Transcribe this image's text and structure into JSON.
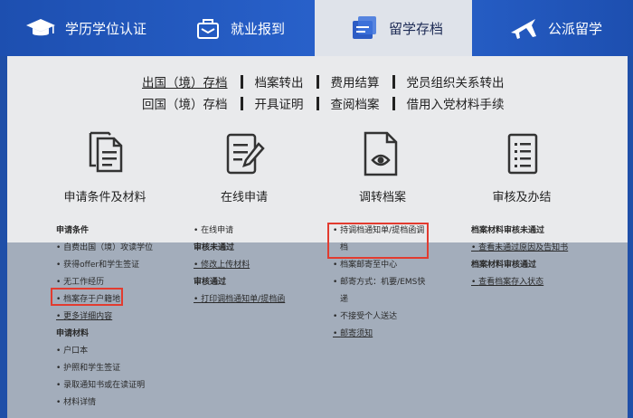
{
  "nav": {
    "items": [
      {
        "label": "学历学位认证",
        "icon": "graduation-cap-icon"
      },
      {
        "label": "就业报到",
        "icon": "job-report-icon"
      },
      {
        "label": "留学存档",
        "icon": "archive-icon"
      },
      {
        "label": "公派留学",
        "icon": "airplane-icon"
      }
    ],
    "active": "留学存档"
  },
  "links": {
    "row1": [
      "出国（境）存档",
      "档案转出",
      "费用结算",
      "党员组织关系转出"
    ],
    "row2": [
      "回国（境）存档",
      "开具证明",
      "查阅档案",
      "借用入党材料手续"
    ]
  },
  "columns": [
    {
      "title": "申请条件及材料",
      "icon": "documents-icon"
    },
    {
      "title": "在线申请",
      "icon": "edit-form-icon"
    },
    {
      "title": "调转档案",
      "icon": "file-eye-icon"
    },
    {
      "title": "审核及办结",
      "icon": "checklist-icon"
    }
  ],
  "lists": {
    "col1": [
      {
        "t": "申请条件",
        "k": "h"
      },
      {
        "t": "自费出国（境）攻读学位",
        "k": "b"
      },
      {
        "t": "获得offer和学生签证",
        "k": "b"
      },
      {
        "t": "无工作经历",
        "k": "b"
      },
      {
        "t": "档案存于户籍地",
        "k": "b"
      },
      {
        "t": "更多详细内容",
        "k": "bu"
      },
      {
        "t": "申请材料",
        "k": "h"
      },
      {
        "t": "户口本",
        "k": "b"
      },
      {
        "t": "护照和学生签证",
        "k": "b"
      },
      {
        "t": "录取通知书或在读证明",
        "k": "b"
      },
      {
        "t": "材料详情",
        "k": "b"
      }
    ],
    "col2": [
      {
        "t": "在线申请",
        "k": "b"
      },
      {
        "t": "审核未通过",
        "k": "h"
      },
      {
        "t": "修改上传材料",
        "k": "bu"
      },
      {
        "t": "审核通过",
        "k": "h"
      },
      {
        "t": "打印调档通知单/提档函",
        "k": "bu"
      }
    ],
    "col3": [
      {
        "t": "持调档通知单/提档函调",
        "k": "b"
      },
      {
        "t": "档",
        "k": "c"
      },
      {
        "t": "档案邮寄至中心",
        "k": "b"
      },
      {
        "t": "邮寄方式：机要/EMS快",
        "k": "b"
      },
      {
        "t": "递",
        "k": "c"
      },
      {
        "t": "不接受个人送达",
        "k": "b"
      },
      {
        "t": "邮寄须知",
        "k": "bu"
      }
    ],
    "col4": [
      {
        "t": "档案材料审核未通过",
        "k": "h"
      },
      {
        "t": "查看未通过原因及告知书",
        "k": "bu"
      },
      {
        "t": "档案材料审核通过",
        "k": "h"
      },
      {
        "t": "查看档案存入状态",
        "k": "bu"
      }
    ]
  }
}
